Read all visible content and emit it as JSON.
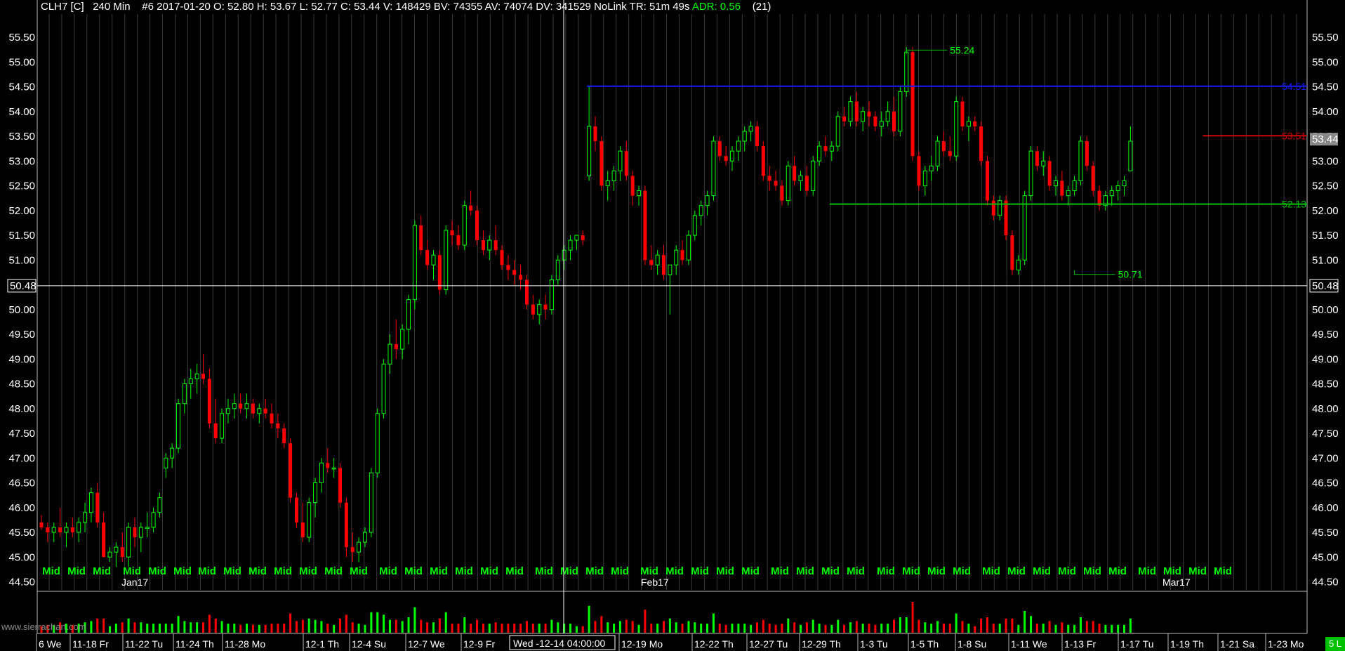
{
  "header": {
    "symbol": "CLH7 [C]",
    "interval": "240 Min",
    "info": "#6 2017-01-20 O: 52.80 H: 53.67 L: 52.77 C: 53.44 V: 148429 BV: 74355 AV: 74074 DV: 341529 NoLink TR: 51m 49s",
    "adr": "ADR: 0.56",
    "count": "(21)"
  },
  "watermark": "www.sierrachart.com",
  "mode_badge": "5 L",
  "crosshair": {
    "price_label": "50.48",
    "time_label": "Wed -12-14  04:00:00"
  },
  "current_price": "53.44",
  "colors": {
    "up": "#00ff00",
    "down": "#ff0000",
    "grid": "#3a3a3a",
    "resistance_blue": "#1a1aff",
    "resistance_red": "#cc0000",
    "support_green": "#00c000"
  },
  "chart_data": {
    "type": "candlestick",
    "title": "",
    "ylim": [
      44.3,
      55.7
    ],
    "y_ticks": [
      "55.50",
      "55.00",
      "54.50",
      "54.00",
      "53.50",
      "53.00",
      "52.50",
      "52.00",
      "51.50",
      "51.00",
      "50.50",
      "50.00",
      "49.50",
      "49.00",
      "48.50",
      "48.00",
      "47.50",
      "47.00",
      "46.50",
      "46.00",
      "45.50",
      "45.00",
      "44.50"
    ],
    "mid_labels": [
      "Mid",
      "Mid",
      "Mid",
      "Mid",
      "Mid",
      "Mid",
      "Mid",
      "Mid",
      "Mid",
      "Mid",
      "Mid",
      "Mid",
      "Mid",
      "Mid",
      "Mid",
      "Mid",
      "Mid",
      "Mid",
      "Mid",
      "Mid",
      "Mid",
      "Mid",
      "Mid",
      "Mid",
      "Mid",
      "Mid",
      "Mid",
      "Mid",
      "Mid",
      "Mid",
      "Mid",
      "Mid",
      "Mid",
      "Mid",
      "Mid",
      "Mid",
      "Mid",
      "Mid",
      "Mid",
      "Mid",
      "Mid",
      "Mid",
      "Mid",
      "Mid",
      "Mid",
      "Mid"
    ],
    "month_labels": [
      "Jan17",
      "Feb17",
      "Mar17"
    ],
    "date_labels": [
      "6 We",
      "11-18 Fr",
      "11-22 Tu",
      "11-24 Th",
      "11-28 Mo",
      "12-1 Th",
      "12-4 Su",
      "12-7 We",
      "12-9 Fr",
      "12-19 Mo",
      "12-22 Th",
      "12-27 Tu",
      "12-29 Th",
      "1-3 Tu",
      "1-5 Th",
      "1-8 Su",
      "1-11 We",
      "1-13 Fr",
      "1-17 Tu",
      "1-19 Th",
      "1-21 Sa",
      "1-23 Mo"
    ],
    "levels": [
      {
        "name": "resistance-blue",
        "value": 54.51,
        "label": "54.51",
        "from_bar": 88
      },
      {
        "name": "resistance-red",
        "value": 53.51,
        "label": "53.51",
        "from_bar": 187
      },
      {
        "name": "support-green",
        "value": 52.13,
        "label": "52.13",
        "from_bar": 127
      }
    ],
    "annotations": [
      {
        "label": "55.24",
        "value": 55.24
      },
      {
        "label": "50.71",
        "value": 50.71
      }
    ],
    "candles": [
      [
        45.7,
        45.85,
        45.55,
        45.6
      ],
      [
        45.6,
        45.7,
        45.3,
        45.5
      ],
      [
        45.5,
        45.7,
        45.3,
        45.6
      ],
      [
        45.6,
        46.0,
        45.4,
        45.5
      ],
      [
        45.5,
        45.7,
        45.2,
        45.6
      ],
      [
        45.6,
        45.8,
        45.4,
        45.5
      ],
      [
        45.5,
        45.8,
        45.3,
        45.7
      ],
      [
        45.7,
        46.1,
        45.5,
        45.9
      ],
      [
        45.9,
        46.4,
        45.7,
        46.3
      ],
      [
        46.3,
        46.5,
        45.6,
        45.7
      ],
      [
        45.7,
        45.9,
        45.0,
        45.0
      ],
      [
        45.0,
        45.2,
        44.9,
        45.1
      ],
      [
        45.1,
        45.3,
        44.8,
        45.2
      ],
      [
        45.2,
        45.5,
        44.9,
        45.0
      ],
      [
        45.0,
        45.7,
        44.8,
        45.6
      ],
      [
        45.6,
        45.8,
        45.2,
        45.4
      ],
      [
        45.4,
        45.7,
        45.1,
        45.6
      ],
      [
        45.6,
        45.9,
        45.4,
        45.6
      ],
      [
        45.6,
        46.0,
        45.5,
        45.9
      ],
      [
        45.9,
        46.3,
        45.8,
        46.2
      ],
      [
        46.8,
        47.1,
        46.6,
        47.0
      ],
      [
        47.0,
        47.3,
        46.8,
        47.2
      ],
      [
        47.2,
        48.2,
        47.1,
        48.1
      ],
      [
        48.1,
        48.6,
        47.9,
        48.5
      ],
      [
        48.5,
        48.8,
        48.2,
        48.6
      ],
      [
        48.6,
        48.9,
        48.3,
        48.7
      ],
      [
        48.7,
        49.1,
        48.5,
        48.6
      ],
      [
        48.6,
        48.8,
        47.6,
        47.7
      ],
      [
        47.7,
        48.2,
        47.3,
        47.4
      ],
      [
        47.4,
        48.0,
        47.3,
        47.9
      ],
      [
        47.9,
        48.2,
        47.7,
        48.0
      ],
      [
        48.0,
        48.3,
        47.8,
        48.1
      ],
      [
        48.1,
        48.3,
        47.9,
        48.0
      ],
      [
        48.0,
        48.3,
        47.8,
        48.1
      ],
      [
        48.1,
        48.2,
        47.8,
        47.9
      ],
      [
        47.9,
        48.1,
        47.7,
        48.0
      ],
      [
        48.0,
        48.2,
        47.8,
        47.9
      ],
      [
        47.9,
        48.1,
        47.6,
        47.7
      ],
      [
        47.7,
        47.9,
        47.4,
        47.6
      ],
      [
        47.6,
        47.7,
        47.2,
        47.3
      ],
      [
        47.3,
        47.4,
        46.1,
        46.2
      ],
      [
        46.2,
        46.3,
        45.6,
        45.7
      ],
      [
        45.7,
        46.1,
        45.3,
        45.4
      ],
      [
        45.4,
        46.2,
        45.3,
        46.1
      ],
      [
        46.1,
        46.6,
        45.8,
        46.5
      ],
      [
        46.5,
        47.0,
        46.3,
        46.9
      ],
      [
        46.9,
        47.2,
        46.7,
        46.8
      ],
      [
        46.8,
        47.0,
        46.6,
        46.8
      ],
      [
        46.8,
        46.9,
        46.0,
        46.1
      ],
      [
        46.1,
        46.2,
        45.0,
        45.2
      ],
      [
        45.2,
        45.5,
        44.9,
        45.1
      ],
      [
        45.1,
        45.4,
        44.9,
        45.3
      ],
      [
        45.3,
        45.6,
        45.2,
        45.5
      ],
      [
        45.5,
        46.8,
        45.4,
        46.7
      ],
      [
        46.7,
        48.0,
        46.6,
        47.9
      ],
      [
        47.9,
        49.0,
        47.8,
        48.9
      ],
      [
        48.9,
        49.5,
        48.7,
        49.3
      ],
      [
        49.3,
        49.8,
        49.0,
        49.2
      ],
      [
        49.2,
        49.7,
        49.0,
        49.6
      ],
      [
        49.6,
        50.3,
        49.3,
        50.2
      ],
      [
        50.2,
        51.8,
        50.0,
        51.7
      ],
      [
        51.7,
        51.9,
        51.1,
        51.2
      ],
      [
        51.2,
        51.4,
        50.8,
        50.9
      ],
      [
        50.9,
        51.2,
        50.6,
        51.1
      ],
      [
        51.1,
        51.2,
        50.3,
        50.4
      ],
      [
        50.4,
        51.7,
        50.3,
        51.6
      ],
      [
        51.6,
        51.8,
        51.3,
        51.5
      ],
      [
        51.5,
        51.7,
        51.2,
        51.3
      ],
      [
        51.3,
        52.2,
        51.2,
        52.1
      ],
      [
        52.1,
        52.4,
        51.9,
        52.0
      ],
      [
        52.0,
        52.1,
        51.3,
        51.4
      ],
      [
        51.4,
        51.6,
        51.1,
        51.2
      ],
      [
        51.2,
        51.5,
        51.0,
        51.4
      ],
      [
        51.4,
        51.7,
        51.1,
        51.2
      ],
      [
        51.2,
        51.3,
        50.8,
        50.9
      ],
      [
        50.9,
        51.1,
        50.6,
        50.8
      ],
      [
        50.8,
        51.0,
        50.5,
        50.7
      ],
      [
        50.7,
        50.9,
        50.4,
        50.6
      ],
      [
        50.6,
        50.7,
        50.0,
        50.1
      ],
      [
        50.1,
        50.3,
        49.8,
        49.9
      ],
      [
        49.9,
        50.2,
        49.7,
        50.1
      ],
      [
        50.1,
        50.3,
        49.8,
        50.0
      ],
      [
        50.0,
        50.7,
        49.9,
        50.6
      ],
      [
        50.6,
        51.1,
        50.5,
        51.0
      ],
      [
        51.0,
        51.3,
        50.8,
        51.2
      ],
      [
        51.2,
        51.5,
        51.0,
        51.4
      ],
      [
        51.4,
        51.5,
        51.2,
        51.5
      ],
      [
        51.5,
        51.6,
        51.3,
        51.4
      ],
      [
        52.7,
        54.5,
        52.6,
        53.7
      ],
      [
        53.7,
        53.9,
        53.2,
        53.4
      ],
      [
        53.4,
        53.5,
        52.4,
        52.5
      ],
      [
        52.5,
        52.8,
        52.2,
        52.6
      ],
      [
        52.6,
        52.9,
        52.4,
        52.8
      ],
      [
        52.8,
        53.3,
        52.6,
        53.2
      ],
      [
        53.2,
        53.4,
        52.6,
        52.7
      ],
      [
        52.7,
        52.8,
        52.1,
        52.3
      ],
      [
        52.3,
        52.5,
        52.1,
        52.4
      ],
      [
        52.4,
        52.5,
        50.9,
        51.0
      ],
      [
        51.0,
        51.3,
        50.8,
        50.9
      ],
      [
        50.9,
        51.2,
        50.7,
        51.1
      ],
      [
        51.1,
        51.3,
        50.6,
        50.7
      ],
      [
        50.7,
        50.8,
        49.9,
        50.9
      ],
      [
        50.9,
        51.3,
        50.7,
        51.2
      ],
      [
        51.2,
        51.4,
        50.9,
        51.0
      ],
      [
        51.0,
        51.6,
        50.9,
        51.5
      ],
      [
        51.5,
        52.0,
        51.4,
        51.9
      ],
      [
        51.9,
        52.2,
        51.7,
        52.1
      ],
      [
        52.1,
        52.4,
        51.9,
        52.3
      ],
      [
        52.3,
        53.5,
        52.2,
        53.4
      ],
      [
        53.4,
        53.5,
        53.0,
        53.1
      ],
      [
        53.1,
        53.3,
        52.9,
        53.0
      ],
      [
        53.0,
        53.3,
        52.8,
        53.2
      ],
      [
        53.2,
        53.5,
        53.0,
        53.4
      ],
      [
        53.4,
        53.7,
        53.2,
        53.6
      ],
      [
        53.6,
        53.8,
        53.4,
        53.7
      ],
      [
        53.7,
        53.8,
        53.2,
        53.3
      ],
      [
        53.3,
        53.4,
        52.6,
        52.7
      ],
      [
        52.7,
        52.9,
        52.4,
        52.6
      ],
      [
        52.6,
        52.8,
        52.4,
        52.5
      ],
      [
        52.5,
        52.6,
        52.1,
        52.2
      ],
      [
        52.2,
        53.0,
        52.1,
        52.9
      ],
      [
        52.9,
        53.1,
        52.5,
        52.6
      ],
      [
        52.6,
        52.8,
        52.4,
        52.7
      ],
      [
        52.7,
        52.9,
        52.3,
        52.4
      ],
      [
        52.4,
        53.1,
        52.3,
        53.0
      ],
      [
        53.0,
        53.4,
        52.9,
        53.3
      ],
      [
        53.3,
        53.5,
        53.1,
        53.2
      ],
      [
        53.2,
        53.4,
        53.0,
        53.3
      ],
      [
        53.3,
        54.0,
        53.2,
        53.9
      ],
      [
        53.9,
        54.1,
        53.7,
        53.8
      ],
      [
        53.8,
        54.3,
        53.7,
        54.2
      ],
      [
        54.2,
        54.4,
        53.7,
        53.8
      ],
      [
        53.8,
        54.1,
        53.6,
        54.0
      ],
      [
        54.0,
        54.2,
        53.7,
        53.9
      ],
      [
        53.9,
        54.0,
        53.6,
        53.7
      ],
      [
        53.7,
        54.0,
        53.5,
        53.8
      ],
      [
        53.8,
        54.2,
        53.7,
        54.0
      ],
      [
        54.0,
        54.3,
        53.5,
        53.6
      ],
      [
        53.6,
        54.5,
        53.5,
        54.4
      ],
      [
        54.4,
        55.3,
        54.3,
        55.2
      ],
      [
        55.2,
        55.3,
        53.0,
        53.1
      ],
      [
        53.1,
        53.2,
        52.4,
        52.5
      ],
      [
        52.5,
        52.9,
        52.3,
        52.8
      ],
      [
        52.8,
        53.1,
        52.6,
        52.9
      ],
      [
        52.9,
        53.5,
        52.8,
        53.4
      ],
      [
        53.4,
        53.6,
        53.1,
        53.2
      ],
      [
        53.2,
        53.5,
        53.0,
        53.1
      ],
      [
        53.1,
        54.3,
        53.0,
        54.2
      ],
      [
        54.2,
        54.3,
        53.6,
        53.7
      ],
      [
        53.7,
        53.9,
        53.4,
        53.8
      ],
      [
        53.8,
        53.9,
        53.6,
        53.7
      ],
      [
        53.7,
        53.8,
        52.9,
        53.0
      ],
      [
        53.0,
        53.1,
        52.1,
        52.2
      ],
      [
        52.2,
        52.3,
        51.8,
        51.9
      ],
      [
        51.9,
        52.3,
        51.8,
        52.2
      ],
      [
        52.2,
        52.3,
        51.4,
        51.5
      ],
      [
        51.5,
        51.6,
        50.7,
        50.8
      ],
      [
        50.8,
        51.1,
        50.7,
        51.0
      ],
      [
        51.0,
        52.4,
        50.9,
        52.3
      ],
      [
        52.3,
        53.3,
        52.2,
        53.2
      ],
      [
        53.2,
        53.3,
        52.8,
        52.9
      ],
      [
        52.9,
        53.2,
        52.7,
        53.0
      ],
      [
        53.0,
        53.1,
        52.4,
        52.5
      ],
      [
        52.5,
        52.7,
        52.3,
        52.6
      ],
      [
        52.6,
        52.8,
        52.2,
        52.3
      ],
      [
        52.3,
        52.5,
        52.1,
        52.4
      ],
      [
        52.4,
        52.7,
        52.3,
        52.6
      ],
      [
        52.6,
        53.5,
        52.5,
        53.4
      ],
      [
        53.4,
        53.5,
        52.8,
        52.9
      ],
      [
        52.9,
        53.0,
        52.3,
        52.4
      ],
      [
        52.4,
        52.5,
        52.0,
        52.1
      ],
      [
        52.1,
        52.4,
        52.0,
        52.3
      ],
      [
        52.3,
        52.5,
        52.1,
        52.4
      ],
      [
        52.4,
        52.6,
        52.2,
        52.5
      ],
      [
        52.5,
        52.7,
        52.3,
        52.6
      ],
      [
        52.8,
        53.7,
        52.8,
        53.4
      ]
    ]
  }
}
